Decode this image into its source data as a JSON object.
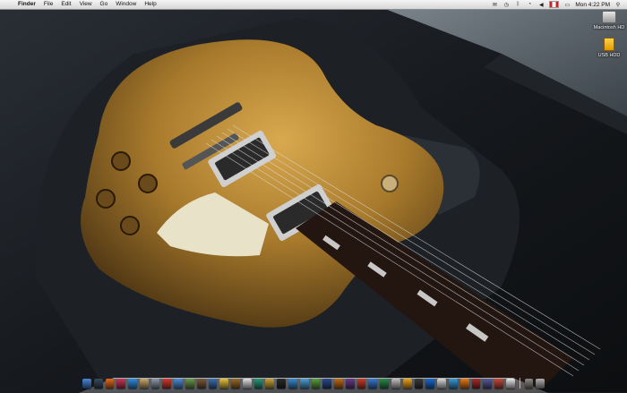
{
  "menubar": {
    "app_name": "Finder",
    "menus": [
      "File",
      "Edit",
      "View",
      "Go",
      "Window",
      "Help"
    ],
    "clock": "Mon 4:22 PM"
  },
  "desktop_icons": [
    {
      "label": "Macintosh HD",
      "icon": "hard-drive-icon"
    },
    {
      "label": "USB HDD",
      "icon": "usb-drive-icon"
    }
  ],
  "dock": {
    "items": [
      {
        "icon": "finder-icon",
        "color": "#4a86d8"
      },
      {
        "icon": "dashboard-icon",
        "color": "#3b4a5e"
      },
      {
        "icon": "firefox-icon",
        "color": "#e66a1f"
      },
      {
        "icon": "itunes-icon",
        "color": "#c8365a"
      },
      {
        "icon": "safari-icon",
        "color": "#2f8fe0"
      },
      {
        "icon": "preview-icon",
        "color": "#c9a96e"
      },
      {
        "icon": "system-preferences-icon",
        "color": "#8e9aa6"
      },
      {
        "icon": "ical-icon",
        "color": "#d23a30"
      },
      {
        "icon": "mail-icon",
        "color": "#4b8ed6"
      },
      {
        "icon": "photo-icon",
        "color": "#6b9a4a"
      },
      {
        "icon": "address-book-icon",
        "color": "#7a5a3a"
      },
      {
        "icon": "iphoto-icon",
        "color": "#3a6fb0"
      },
      {
        "icon": "star-icon",
        "color": "#e8c23a"
      },
      {
        "icon": "guitar-icon",
        "color": "#9a6a2a"
      },
      {
        "icon": "textedit-icon",
        "color": "#e0e0e0"
      },
      {
        "icon": "time-machine-icon",
        "color": "#2a9a7a"
      },
      {
        "icon": "app-icon",
        "color": "#c9a33a"
      },
      {
        "icon": "terminal-icon",
        "color": "#2a2a2a"
      },
      {
        "icon": "activity-monitor-icon",
        "color": "#3a8ad0"
      },
      {
        "icon": "world-icon",
        "color": "#4aa0d8"
      },
      {
        "icon": "utility-icon",
        "color": "#5aa040"
      },
      {
        "icon": "photoshop-icon",
        "color": "#2a4a8a"
      },
      {
        "icon": "illustrator-icon",
        "color": "#c06a1a"
      },
      {
        "icon": "app-icon",
        "color": "#6a3a8a"
      },
      {
        "icon": "app-icon",
        "color": "#d03a2a"
      },
      {
        "icon": "app-icon",
        "color": "#3a7ad0"
      },
      {
        "icon": "app-icon",
        "color": "#2a8a4a"
      },
      {
        "icon": "app-icon",
        "color": "#c0c0c0"
      },
      {
        "icon": "app-icon",
        "color": "#e8a020"
      },
      {
        "icon": "app-icon",
        "color": "#3a3a3a"
      },
      {
        "icon": "app-icon",
        "color": "#1a6ad0"
      },
      {
        "icon": "app-icon",
        "color": "#d8d8d8"
      },
      {
        "icon": "app-icon",
        "color": "#3a9ad8"
      },
      {
        "icon": "vlc-icon",
        "color": "#e87a1a"
      },
      {
        "icon": "app-icon",
        "color": "#aa2a2a"
      },
      {
        "icon": "app-icon",
        "color": "#5a5a9a"
      },
      {
        "icon": "app-icon",
        "color": "#c84a3a"
      },
      {
        "icon": "ical-icon",
        "color": "#e8e8e8"
      }
    ],
    "trailing": [
      {
        "icon": "documents-stack-icon",
        "color": "#8a8a8a"
      },
      {
        "icon": "trash-icon",
        "color": "#b0b0b0"
      }
    ]
  }
}
